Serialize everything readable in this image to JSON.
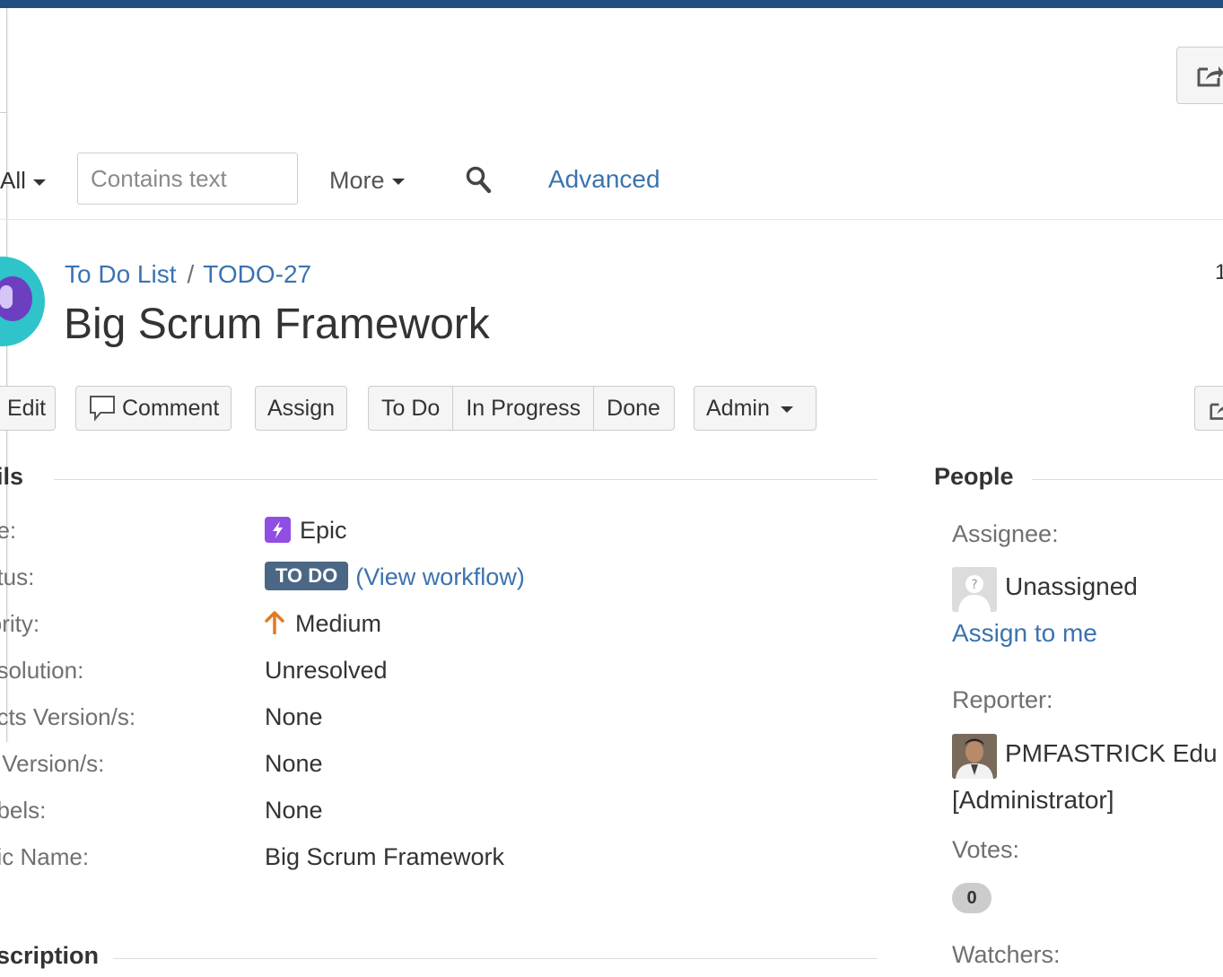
{
  "filter": {
    "all_label": "All",
    "search_placeholder": "Contains text",
    "more_label": "More",
    "advanced_label": "Advanced"
  },
  "issue": {
    "project": "To Do List",
    "separator": "/",
    "key": "TODO-27",
    "title": "Big Scrum Framework",
    "right_edge_text": "1"
  },
  "toolbar": {
    "edit": "Edit",
    "comment": "Comment",
    "assign": "Assign",
    "todo": "To Do",
    "in_progress": "In Progress",
    "done": "Done",
    "admin": "Admin"
  },
  "details": {
    "heading": "ils",
    "rows": [
      {
        "label": "pe:",
        "value": "Epic"
      },
      {
        "label": "atus:",
        "value": "TO DO",
        "link": "View workflow"
      },
      {
        "label": "iority:",
        "value": "Medium"
      },
      {
        "label": "esolution:",
        "value": "Unresolved"
      },
      {
        "label": "ects Version/s:",
        "value": "None"
      },
      {
        "label": "x Version/s:",
        "value": "None"
      },
      {
        "label": "abels:",
        "value": "None"
      },
      {
        "label": "pic Name:",
        "value": "Big Scrum Framework"
      }
    ]
  },
  "description": {
    "heading": "scription"
  },
  "people": {
    "heading": "People",
    "assignee_label": "Assignee:",
    "assignee_value": "Unassigned",
    "assign_to_me": "Assign to me",
    "reporter_label": "Reporter:",
    "reporter_name": "PMFASTRICK Edu",
    "reporter_role": "[Administrator]",
    "votes_label": "Votes:",
    "votes_count": "0",
    "watchers_label": "Watchers:"
  },
  "colors": {
    "header": "#205081",
    "link": "#3b73af",
    "status_lozenge": "#4a6785",
    "epic": "#904ee2",
    "priority_medium": "#e07b24"
  }
}
